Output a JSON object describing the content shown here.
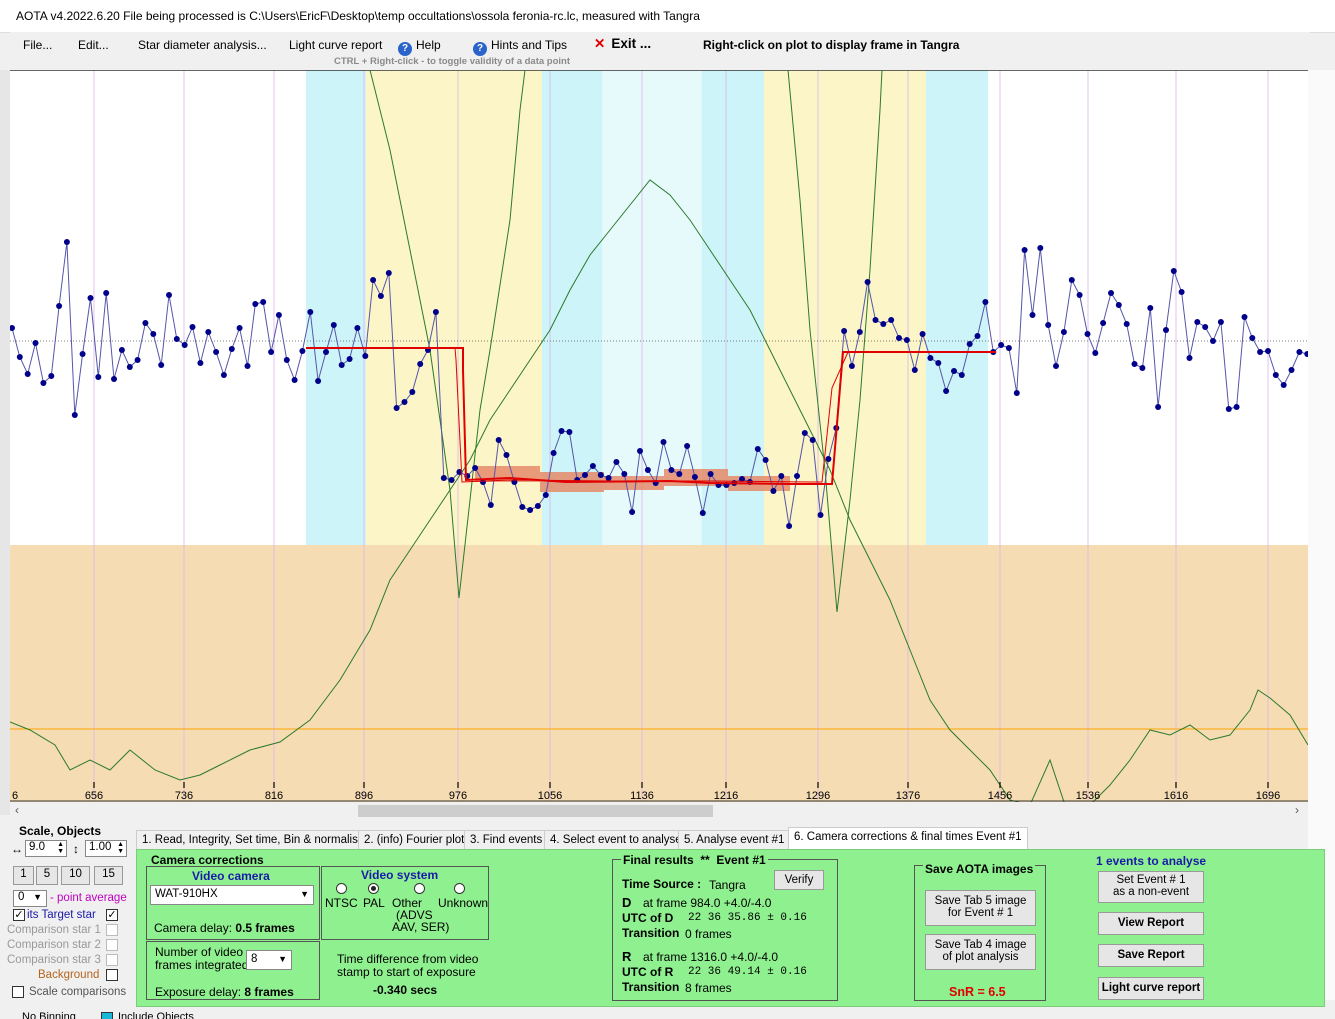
{
  "colors": {
    "accent_red": "#e00000",
    "panel_green": "#8ff08f",
    "point_blue": "#00008b",
    "band_yellow": "#fbf5c8",
    "band_cyan": "#cdf4f8",
    "band_lightcyan": "#e6fafc",
    "tan": "#f5dcb3"
  },
  "window": {
    "title": "AOTA v4.2022.6.20   File being processed is C:\\Users\\EricF\\Desktop\\temp occultations\\ossola feronia-rc.lc, measured with Tangra"
  },
  "menu": {
    "file": "File...",
    "edit": "Edit...",
    "star_diameter": "Star diameter analysis...",
    "light_curve_report": "Light curve report",
    "help": "Help",
    "hints": "Hints and Tips",
    "exit": "Exit ...",
    "right_click_hint": "Right-click on plot to display frame in Tangra",
    "ctrl_hint_key": "CTRL + Right-click",
    "ctrl_hint_text": " -  to toggle validity of a data point"
  },
  "axis": {
    "ticks": [
      "656",
      "736",
      "816",
      "896",
      "976",
      "1056",
      "1136",
      "1216",
      "1296",
      "1376",
      "1456",
      "1536",
      "1616",
      "1696"
    ],
    "first_tick": "6"
  },
  "left_panel": {
    "scale_label": "Scale,  Objects",
    "h_scale": "9.0",
    "v_scale": "1.00",
    "buttons": [
      "1",
      "5",
      "10",
      "15"
    ],
    "avg_value": "0",
    "avg_label": "- point average",
    "target_label": "its   Target star",
    "comp1": "Comparison star 1",
    "comp2": "Comparison star 2",
    "comp3": "Comparison star 3",
    "background": "Background",
    "scale_comp": "Scale comparisons"
  },
  "tabs": [
    "1.  Read, Integrity, Set time, Bin & normalise",
    "2. (info)  Fourier plot",
    "3. Find events",
    "4. Select event to analyse",
    "5. Analyse event #1",
    "6. Camera corrections & final times Event #1"
  ],
  "camera": {
    "title": "Camera corrections",
    "video_camera_label": "Video camera",
    "camera_model": "WAT-910HX",
    "camera_delay_label": "Camera delay:",
    "camera_delay_value": "0.5 frames",
    "video_system_label": "Video system",
    "ntsc": "NTSC",
    "pal": "PAL",
    "other": "Other",
    "other_detail1": "(ADVS",
    "other_detail2": "AAV, SER)",
    "unknown": "Unknown",
    "frames_integrated_label1": "Number of video",
    "frames_integrated_label2": "frames integrated",
    "frames_integrated_value": "8",
    "exposure_delay_label": "Exposure delay:",
    "exposure_delay_value": "8 frames",
    "time_diff_label1": "Time difference from video",
    "time_diff_label2": "stamp to start of exposure",
    "time_diff_value": "-0.340 secs"
  },
  "results": {
    "title": "Final results",
    "stars": "**",
    "event": "Event #1",
    "time_source_label": "Time Source :",
    "time_source_value": "Tangra",
    "verify": "Verify",
    "d_label": "D",
    "d_frame": "at frame 984.0  +4.0/-4.0",
    "d_utc_label": "UTC of D",
    "d_utc": "22 36 35.86  ± 0.16",
    "d_trans_label": "Transition",
    "d_trans": "0 frames",
    "r_label": "R",
    "r_frame": "at frame 1316.0  +4.0/-4.0",
    "r_utc_label": "UTC of R",
    "r_utc": "22 36 49.14  ± 0.16",
    "r_trans_label": "Transition",
    "r_trans": "8 frames"
  },
  "save_images": {
    "title": "Save AOTA images",
    "tab5_l1": "Save Tab 5 image",
    "tab5_l2": "for Event # 1",
    "tab4_l1": "Save Tab 4 image",
    "tab4_l2": "of plot analysis",
    "snr": "SnR = 6.5"
  },
  "report": {
    "events_label": "1  events to analyse",
    "set_event_l1": "Set Event # 1",
    "set_event_l2": "as a non-event",
    "view_report": "View Report",
    "save_report": "Save Report",
    "light_curve_report": "Light curve report"
  },
  "bottom": {
    "no_binning": "No Binning",
    "include_objects": "Include Objects"
  }
}
